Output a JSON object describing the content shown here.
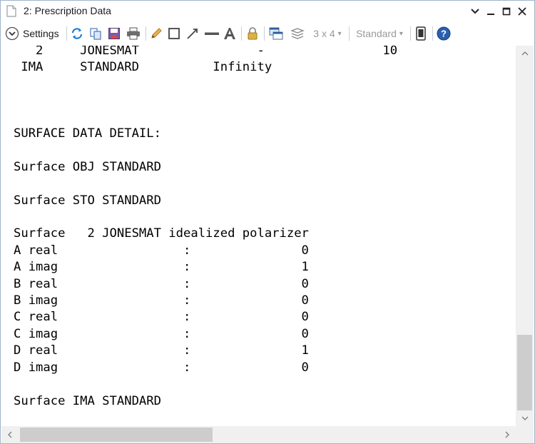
{
  "window": {
    "title": "2: Prescription Data"
  },
  "toolbar": {
    "settings_label": "Settings",
    "layout_label": "3 x 4",
    "layout_arrow": "▾",
    "style_label": "Standard",
    "style_arrow": "▾",
    "help_label": "?"
  },
  "content": {
    "lines": [
      "   2     JONESMAT                -                10",
      " IMA     STANDARD          Infinity",
      "",
      "",
      "",
      "SURFACE DATA DETAIL:",
      "",
      "Surface OBJ STANDARD",
      "",
      "Surface STO STANDARD",
      "",
      "Surface   2 JONESMAT idealized polarizer",
      "A real                 :               0",
      "A imag                 :               1",
      "B real                 :               0",
      "B imag                 :               0",
      "C real                 :               0",
      "C imag                 :               0",
      "D real                 :               1",
      "D imag                 :               0",
      "",
      "Surface IMA STANDARD"
    ]
  },
  "colors": {
    "accent": "#1e7bd6",
    "border": "#9fb3c8",
    "scroll_thumb": "#cdcdcd"
  }
}
